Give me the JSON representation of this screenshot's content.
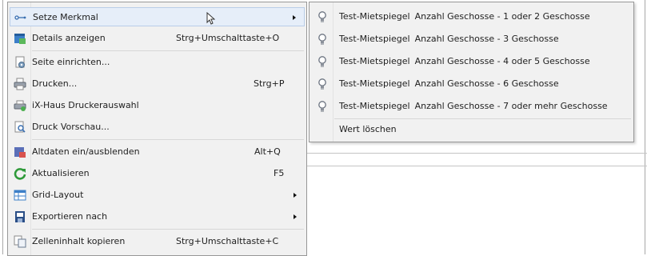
{
  "menu": {
    "items": [
      {
        "label": "Setze Merkmal",
        "shortcut": "",
        "icon": "set-feature-icon",
        "submenu": true,
        "highlighted": true
      },
      {
        "label": "Details anzeigen",
        "shortcut": "Strg+Umschalttaste+O",
        "icon": "details-icon"
      },
      {
        "label": "Seite einrichten...",
        "shortcut": "",
        "icon": "page-setup-icon"
      },
      {
        "label": "Drucken...",
        "shortcut": "Strg+P",
        "icon": "print-icon"
      },
      {
        "label": "iX-Haus Druckerauswahl",
        "shortcut": "",
        "icon": "printer-select-icon"
      },
      {
        "label": "Druck Vorschau...",
        "shortcut": "",
        "icon": "print-preview-icon"
      },
      {
        "label": "Altdaten ein/ausblenden",
        "shortcut": "Alt+Q",
        "icon": "toggle-old-data-icon"
      },
      {
        "label": "Aktualisieren",
        "shortcut": "F5",
        "icon": "refresh-icon"
      },
      {
        "label": "Grid-Layout",
        "shortcut": "",
        "icon": "grid-layout-icon",
        "submenu": true
      },
      {
        "label": "Exportieren nach",
        "shortcut": "",
        "icon": "export-icon",
        "submenu": true
      },
      {
        "label": "Zelleninhalt kopieren",
        "shortcut": "Strg+Umschalttaste+C",
        "icon": "copy-cell-icon"
      }
    ]
  },
  "submenu": {
    "items": [
      {
        "group": "Test-Mietspiegel",
        "value": "Anzahl Geschosse - 1 oder 2 Geschosse"
      },
      {
        "group": "Test-Mietspiegel",
        "value": "Anzahl Geschosse - 3 Geschosse"
      },
      {
        "group": "Test-Mietspiegel",
        "value": "Anzahl Geschosse - 4 oder 5 Geschosse"
      },
      {
        "group": "Test-Mietspiegel",
        "value": "Anzahl Geschosse - 6 Geschosse"
      },
      {
        "group": "Test-Mietspiegel",
        "value": "Anzahl Geschosse - 7 oder mehr Geschosse"
      }
    ],
    "clear_label": "Wert löschen",
    "item_icon": "bulb-icon"
  },
  "colors": {
    "menu_bg": "#f1f1f1",
    "highlight_bg": "#e6eef9",
    "highlight_border": "#b9cde8",
    "border": "#979797"
  }
}
